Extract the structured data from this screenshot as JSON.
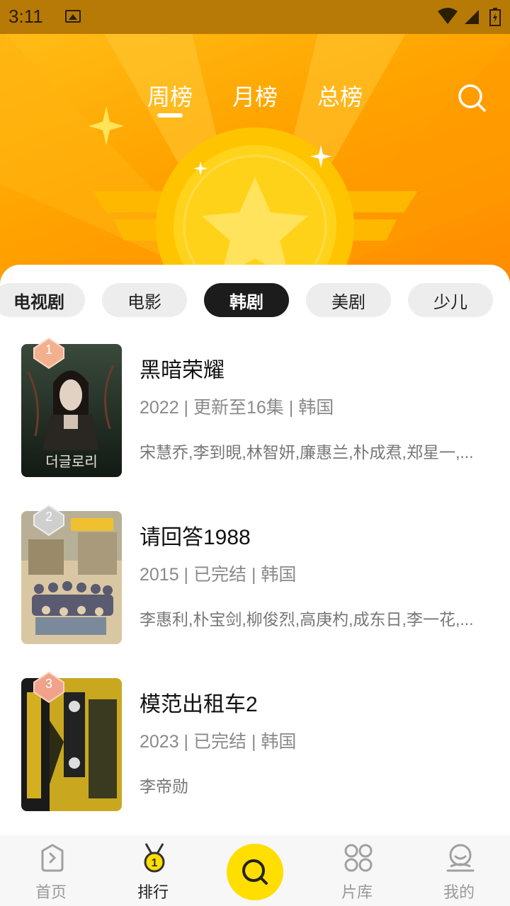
{
  "status": {
    "time": "3:11"
  },
  "top_tabs": [
    {
      "label": "周榜",
      "active": true
    },
    {
      "label": "月榜",
      "active": false
    },
    {
      "label": "总榜",
      "active": false
    }
  ],
  "categories": [
    {
      "label": "电视剧",
      "active": false
    },
    {
      "label": "电影",
      "active": false
    },
    {
      "label": "韩剧",
      "active": true
    },
    {
      "label": "美剧",
      "active": false
    },
    {
      "label": "少儿",
      "active": false
    }
  ],
  "list": [
    {
      "rank": "1",
      "title": "黑暗荣耀",
      "meta": "2022 | 更新至16集 | 韩国",
      "cast": "宋慧乔,李到晛,林智妍,廉惠兰,朴成焄,郑星一,...",
      "poster_text": "더글로리",
      "rank_color": "#f2a98a"
    },
    {
      "rank": "2",
      "title": "请回答1988",
      "meta": "2015 | 已完结 | 韩国",
      "cast": "李惠利,朴宝剑,柳俊烈,高庚杓,成东日,李一花,...",
      "poster_text": "",
      "rank_color": "#cfcfcf"
    },
    {
      "rank": "3",
      "title": "模范出租车2",
      "meta": "2023 | 已完结 | 韩国",
      "cast": "李帝勋",
      "poster_text": "",
      "rank_color": "#f0a38a"
    }
  ],
  "bottom_nav": [
    {
      "label": "首页",
      "icon": "home-icon",
      "active": false
    },
    {
      "label": "排行",
      "icon": "medal-icon",
      "active": true
    },
    {
      "label": "",
      "icon": "search-icon",
      "active": false
    },
    {
      "label": "片库",
      "icon": "grid-icon",
      "active": false
    },
    {
      "label": "我的",
      "icon": "user-icon",
      "active": false
    }
  ],
  "colors": {
    "accent": "#ffde00",
    "hero_orange": "#ffa400"
  }
}
